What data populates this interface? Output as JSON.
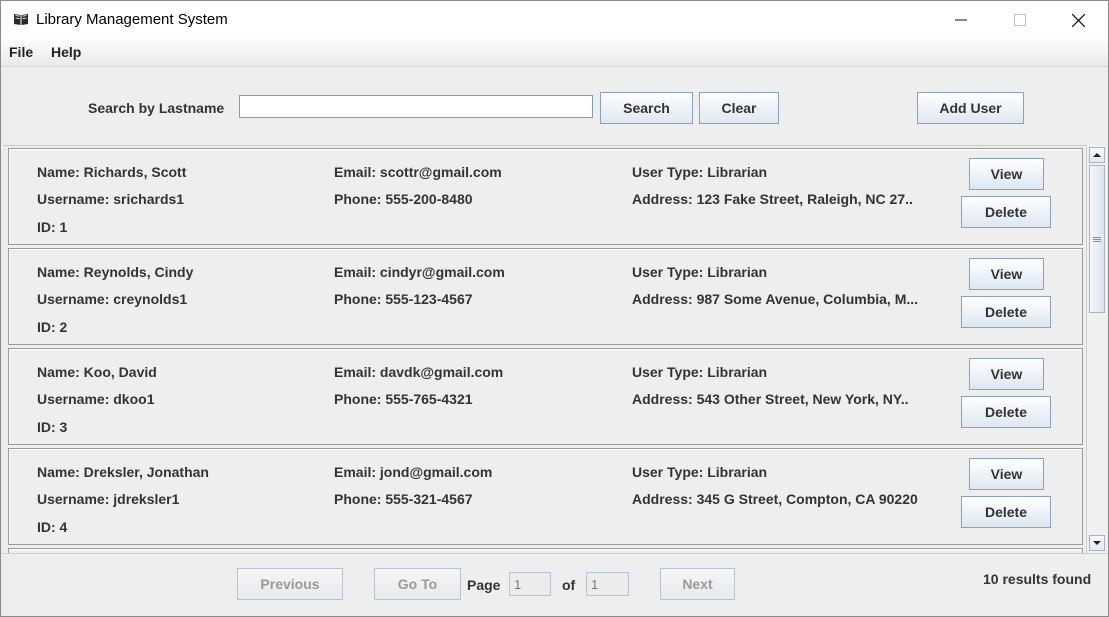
{
  "window": {
    "title": "Library Management System",
    "app_icon": "open-book-icon"
  },
  "menu": {
    "file": "File",
    "help": "Help"
  },
  "search": {
    "label": "Search by Lastname",
    "value": "",
    "search_button": "Search",
    "clear_button": "Clear",
    "add_user_button": "Add User"
  },
  "users": [
    {
      "name": "Name: Richards, Scott",
      "username": "Username: srichards1",
      "id": "ID: 1",
      "email": "Email: scottr@gmail.com",
      "phone": "Phone: 555-200-8480",
      "type": "User Type: Librarian",
      "address": "Address: 123 Fake Street, Raleigh, NC 27..",
      "view": "View",
      "delete": "Delete"
    },
    {
      "name": "Name: Reynolds, Cindy",
      "username": "Username: creynolds1",
      "id": "ID: 2",
      "email": "Email: cindyr@gmail.com",
      "phone": "Phone: 555-123-4567",
      "type": "User Type: Librarian",
      "address": "Address: 987 Some Avenue, Columbia, M...",
      "view": "View",
      "delete": "Delete"
    },
    {
      "name": "Name: Koo, David",
      "username": "Username: dkoo1",
      "id": "ID: 3",
      "email": "Email: davdk@gmail.com",
      "phone": "Phone: 555-765-4321",
      "type": "User Type: Librarian",
      "address": "Address: 543 Other Street, New York, NY..",
      "view": "View",
      "delete": "Delete"
    },
    {
      "name": "Name: Dreksler, Jonathan",
      "username": "Username: jdreksler1",
      "id": "ID: 4",
      "email": "Email: jond@gmail.com",
      "phone": "Phone: 555-321-4567",
      "type": "User Type: Librarian",
      "address": "Address: 345 G Street, Compton, CA 90220",
      "view": "View",
      "delete": "Delete"
    }
  ],
  "pagination": {
    "previous": "Previous",
    "goto": "Go To",
    "page_label": "Page",
    "page_value": "1",
    "of_label": "of",
    "total_pages": "1",
    "next": "Next",
    "results": "10 results found"
  }
}
